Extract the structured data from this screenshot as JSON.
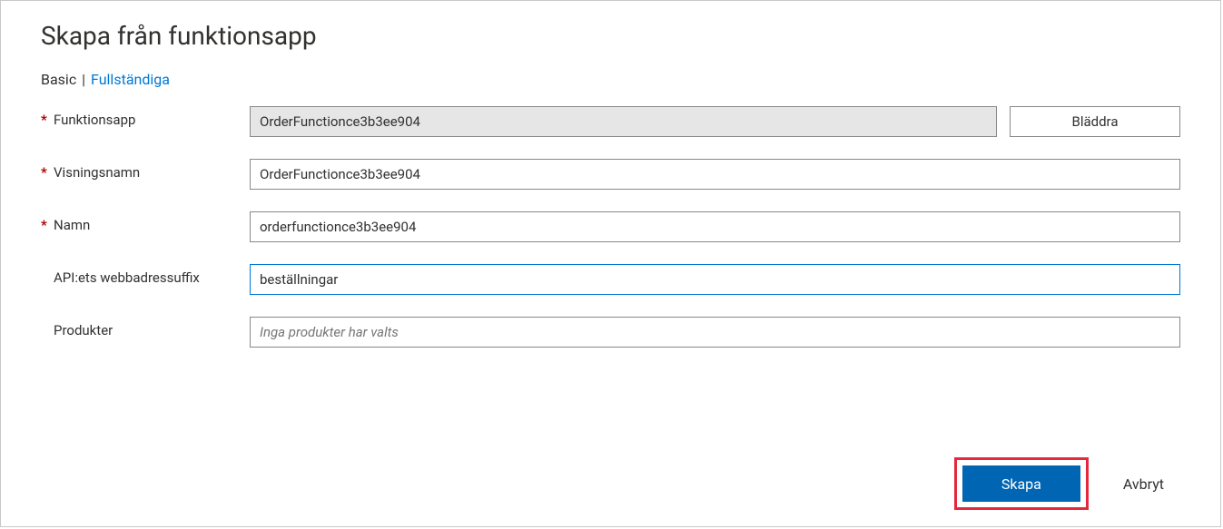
{
  "title": "Skapa från funktionsapp",
  "tabs": {
    "basic": "Basic",
    "separator": "|",
    "full": "Fullständiga"
  },
  "fields": {
    "funktionsapp": {
      "label": "Funktionsapp",
      "value": "OrderFunctionce3b3ee904",
      "browse_label": "Bläddra"
    },
    "visningsnamn": {
      "label": "Visningsnamn",
      "value": "OrderFunctionce3b3ee904"
    },
    "namn": {
      "label": "Namn",
      "value": "orderfunctionce3b3ee904"
    },
    "api_suffix": {
      "label": "API:ets webbadressuffix",
      "value": "beställningar"
    },
    "produkter": {
      "label": "Produkter",
      "placeholder": "Inga produkter har valts"
    }
  },
  "footer": {
    "create": "Skapa",
    "cancel": "Avbryt"
  }
}
